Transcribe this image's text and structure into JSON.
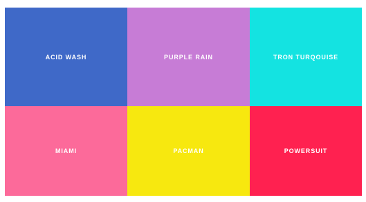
{
  "swatches": [
    {
      "label": "ACID WASH",
      "color": "#3f69c8"
    },
    {
      "label": "PURPLE RAIN",
      "color": "#c77cd6"
    },
    {
      "label": "TRON TURQOUISE",
      "color": "#14e3e1"
    },
    {
      "label": "MIAMI",
      "color": "#fc6a9a"
    },
    {
      "label": "PACMAN",
      "color": "#f7e80f"
    },
    {
      "label": "POWERSUIT",
      "color": "#ff2150"
    }
  ]
}
